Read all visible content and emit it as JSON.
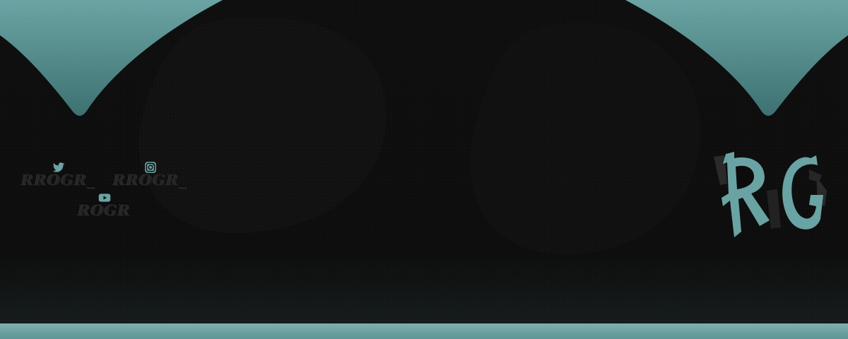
{
  "banner": {
    "accent_color": "#6aa3a3",
    "accent_dark": "#3f7575",
    "background_color": "#0c0c0c",
    "logo_text": "RG",
    "social": [
      {
        "platform": "twitter",
        "icon": "twitter-icon",
        "handle": "RROGR_"
      },
      {
        "platform": "instagram",
        "icon": "instagram-icon",
        "handle": "RROGR_"
      },
      {
        "platform": "youtube",
        "icon": "youtube-icon",
        "handle": "ROGR"
      }
    ]
  }
}
